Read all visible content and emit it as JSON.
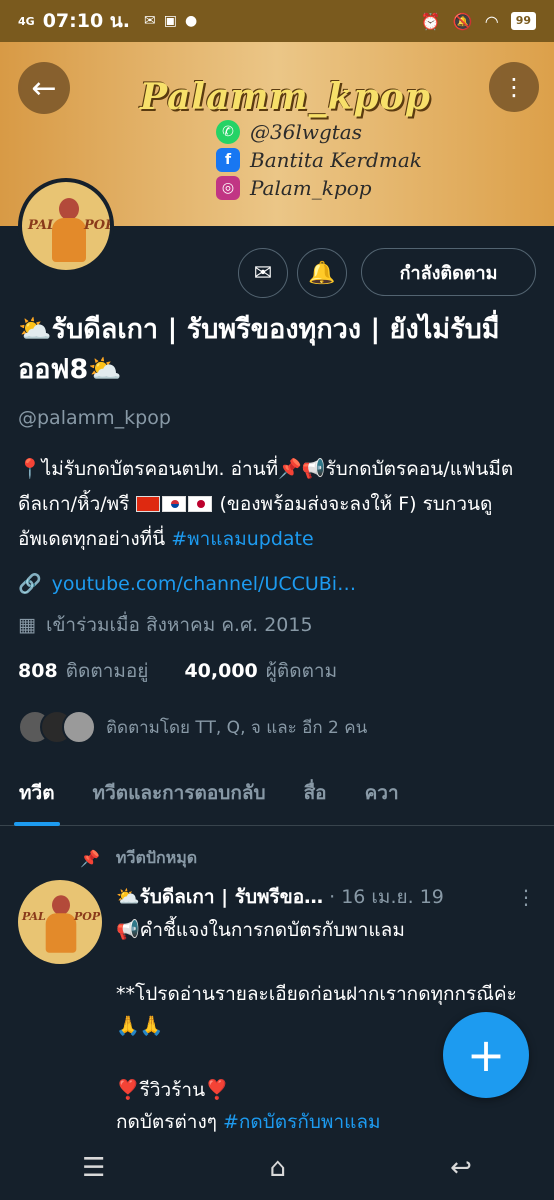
{
  "status_bar": {
    "network": "4G",
    "time": "07:10 น.",
    "left_icons": [
      "messenger-icon",
      "line-icon",
      "chat-icon"
    ],
    "right_icons": [
      "alarm-icon",
      "mute-icon",
      "wifi-icon"
    ],
    "battery": "99"
  },
  "banner": {
    "title": "Palamm_kpop",
    "social": [
      {
        "icon": "whatsapp-icon",
        "text": "@36lwgtas"
      },
      {
        "icon": "facebook-icon",
        "text": "Bantita Kerdmak"
      },
      {
        "icon": "instagram-icon",
        "text": "Palam_kpop"
      }
    ]
  },
  "avatar_text": {
    "left": "PAL",
    "right": "POP"
  },
  "profile": {
    "follow_button": "กำลังติดตาม",
    "name": "⛅รับดีลเกา | รับพรีของทุกวง | ยังไม่รับมื่ออฟ8⛅",
    "handle": "@palamm_kpop",
    "bio_part1": "📍ไม่รับกดบัตรคอนตปท. อ่านที่📌📢รับกดบัตรคอน/แฟนมีต ดีลเกา/หิ้ว/พรี ",
    "bio_part2": " (ของพร้อมส่งจะลงให้ F) รบกวนดูอัพเดตทุกอย่างที่นี่ ",
    "bio_hashtag": "#พาแลมupdate",
    "link": "youtube.com/channel/UCCUBi…",
    "joined": "เข้าร่วมเมื่อ สิงหาคม ค.ศ. 2015",
    "following_count": "808",
    "following_label": "ติดตามอยู่",
    "followers_count": "40,000",
    "followers_label": "ผู้ติดตาม",
    "followed_by": "ติดตามโดย TT, Q, จ และ อีก 2 คน"
  },
  "tabs": [
    "ทวีต",
    "ทวีตและการตอบกลับ",
    "สื่อ",
    "ควา"
  ],
  "pinned_tweet": {
    "pinned_label": "ทวีตปักหมุด",
    "name": "⛅รับดีลเกา | รับพรีขอ…",
    "date": "· 16 เม.ย. 19",
    "line1": "📢คำชี้แจงในการกดบัตรกับพาแลม",
    "line2": "**โปรดอ่านรายละเอียดก่อนฝากเรากดทุกกรณีค่ะ🙏🙏",
    "line3": "❣️รีวิวร้าน❣️",
    "line4_prefix": "กดบัตรต่างๆ ",
    "line4_hashtag": "#กดบัตรกับพาแลม"
  },
  "colors": {
    "accent": "#1d9bf0",
    "background": "#15202b",
    "muted": "#8899a6"
  }
}
